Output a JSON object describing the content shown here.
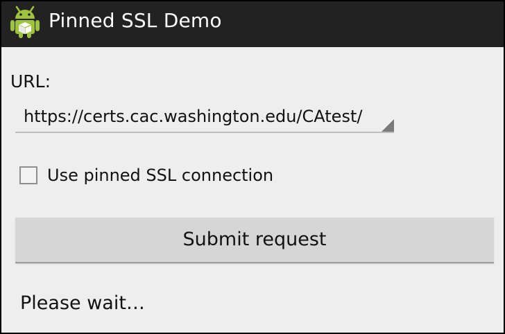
{
  "app": {
    "title": "Pinned SSL Demo",
    "icon": "android-icon"
  },
  "form": {
    "url_label": "URL:",
    "url_value": "https://certs.cac.washington.edu/CAtest/",
    "checkbox_label": "Use pinned SSL connection",
    "checkbox_checked": false,
    "submit_label": "Submit request"
  },
  "status": {
    "text": "Please wait…"
  },
  "colors": {
    "actionbar": "#222222",
    "background": "#eeeeee",
    "android_green": "#9fc33c"
  }
}
